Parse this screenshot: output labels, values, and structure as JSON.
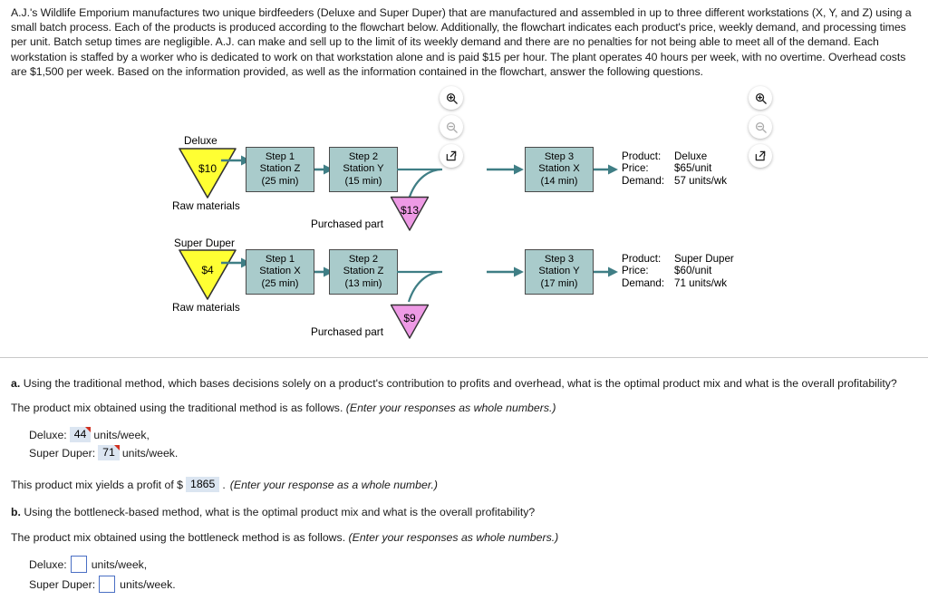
{
  "intro": {
    "paragraph": "A.J.'s Wildlife Emporium manufactures two unique birdfeeders (Deluxe and Super Duper) that are manufactured and assembled in up to three different workstations (X, Y, and Z) using a small batch process. Each of the products is produced according to the flowchart below. Additionally, the flowchart indicates each product's price, weekly demand, and processing times per unit. Batch setup times are negligible. A.J. can make and sell up to the limit of its weekly demand and there are no penalties for not being able to meet all of the demand. Each workstation is staffed by a worker who is dedicated to work on that workstation alone and is paid $15 per hour. The plant operates 40 hours per week, with no overtime. Overhead costs are $1,500 per week. Based on the information provided, as well as the information contained in the flowchart, answer the following questions."
  },
  "toolbar": {
    "zoom_in_label": "zoom-in",
    "zoom_out_label": "zoom-out",
    "popout_label": "open-in-new-window"
  },
  "flowchart": {
    "colors": {
      "process_fill": "#a9cbcb",
      "process_border": "#4a4a4a",
      "raw_material_fill": "#ffff33",
      "purchased_part_fill": "#ee9ae5",
      "connector": "#3f7e85"
    },
    "rows": [
      {
        "product_label": "Deluxe",
        "raw_value": "$10",
        "raw_caption": "Raw materials",
        "steps": [
          {
            "step": "Step 1",
            "station": "Station Z",
            "time": "(25 min)"
          },
          {
            "step": "Step 2",
            "station": "Station Y",
            "time": "(15 min)"
          },
          {
            "step": "Step 3",
            "station": "Station X",
            "time": "(14 min)"
          }
        ],
        "purchased_value": "$13",
        "purchased_caption": "Purchased part",
        "info": {
          "product_key": "Product:",
          "product_value": "Deluxe",
          "price_key": "Price:",
          "price_value": "$65/unit",
          "demand_key": "Demand:",
          "demand_value": "57 units/wk"
        }
      },
      {
        "product_label": "Super Duper",
        "raw_value": "$4",
        "raw_caption": "Raw materials",
        "steps": [
          {
            "step": "Step 1",
            "station": "Station X",
            "time": "(25 min)"
          },
          {
            "step": "Step 2",
            "station": "Station Z",
            "time": "(13 min)"
          },
          {
            "step": "Step 3",
            "station": "Station Y",
            "time": "(17 min)"
          }
        ],
        "purchased_value": "$9",
        "purchased_caption": "Purchased part",
        "info": {
          "product_key": "Product:",
          "product_value": "Super Duper",
          "price_key": "Price:",
          "price_value": "$60/unit",
          "demand_key": "Demand:",
          "demand_value": "71 units/wk"
        }
      }
    ]
  },
  "questions": {
    "a_label": "a.",
    "a_text": "Using the traditional method, which bases decisions solely on a product's contribution to profits and overhead, what is the optimal product mix and what is the overall profitability?",
    "a_instruction": "The product mix obtained using the traditional method is as follows.",
    "a_instruction_italic": "(Enter your responses as whole numbers.)",
    "a_deluxe_label": "Deluxe:",
    "a_deluxe_value": "44",
    "a_deluxe_unit": "units/week,",
    "a_super_label": "Super Duper:",
    "a_super_value": "71",
    "a_super_unit": "units/week.",
    "profit_prefix": "This product mix yields a profit of $",
    "profit_value": "1865",
    "profit_suffix": ".",
    "profit_italic": "(Enter your response as a whole number.)",
    "b_label": "b.",
    "b_text": "Using the bottleneck-based method, what is the optimal product mix and what is the overall profitability?",
    "b_instruction": "The product mix obtained using the bottleneck method is as follows.",
    "b_instruction_italic": "(Enter your responses as whole numbers.)",
    "b_deluxe_label": "Deluxe:",
    "b_deluxe_value": "",
    "b_deluxe_unit": "units/week,",
    "b_super_label": "Super Duper:",
    "b_super_value": "",
    "b_super_unit": "units/week."
  }
}
